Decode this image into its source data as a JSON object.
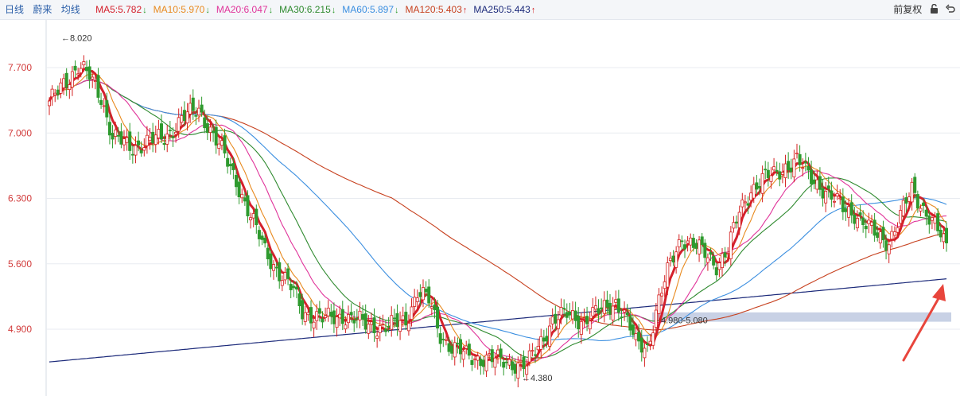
{
  "header": {
    "tabs": [
      "日线",
      "蔚来",
      "均线"
    ],
    "ma_legend": [
      {
        "name": "MA5",
        "value": "5.782",
        "dir": "down",
        "color": "#d4202c"
      },
      {
        "name": "MA10",
        "value": "5.970",
        "dir": "down",
        "color": "#e88a1f"
      },
      {
        "name": "MA20",
        "value": "6.047",
        "dir": "down",
        "color": "#e0349a"
      },
      {
        "name": "MA30",
        "value": "6.215",
        "dir": "down",
        "color": "#2f8a2f"
      },
      {
        "name": "MA60",
        "value": "5.897",
        "dir": "down",
        "color": "#3c8fe0"
      },
      {
        "name": "MA120",
        "value": "5.403",
        "dir": "up",
        "color": "#c7411f"
      },
      {
        "name": "MA250",
        "value": "5.443",
        "dir": "up",
        "color": "#1c2a7a"
      }
    ],
    "adjust_label": "前复权",
    "lock_icon": "lock-icon",
    "undo_icon": "undo-icon",
    "up_color": "#d42020",
    "down_color": "#2e9a2e"
  },
  "chart_data": {
    "type": "candlestick",
    "y_ticks": [
      "7.700",
      "7.000",
      "6.300",
      "5.600",
      "4.900"
    ],
    "ylim": [
      4.3,
      8.1
    ],
    "high_label": "8.020",
    "high_value": 8.02,
    "low_label": "4.380",
    "low_value": 4.38,
    "range_label": "4.980-5.080",
    "range_band": [
      4.98,
      5.08
    ],
    "last_close": 5.78
  }
}
